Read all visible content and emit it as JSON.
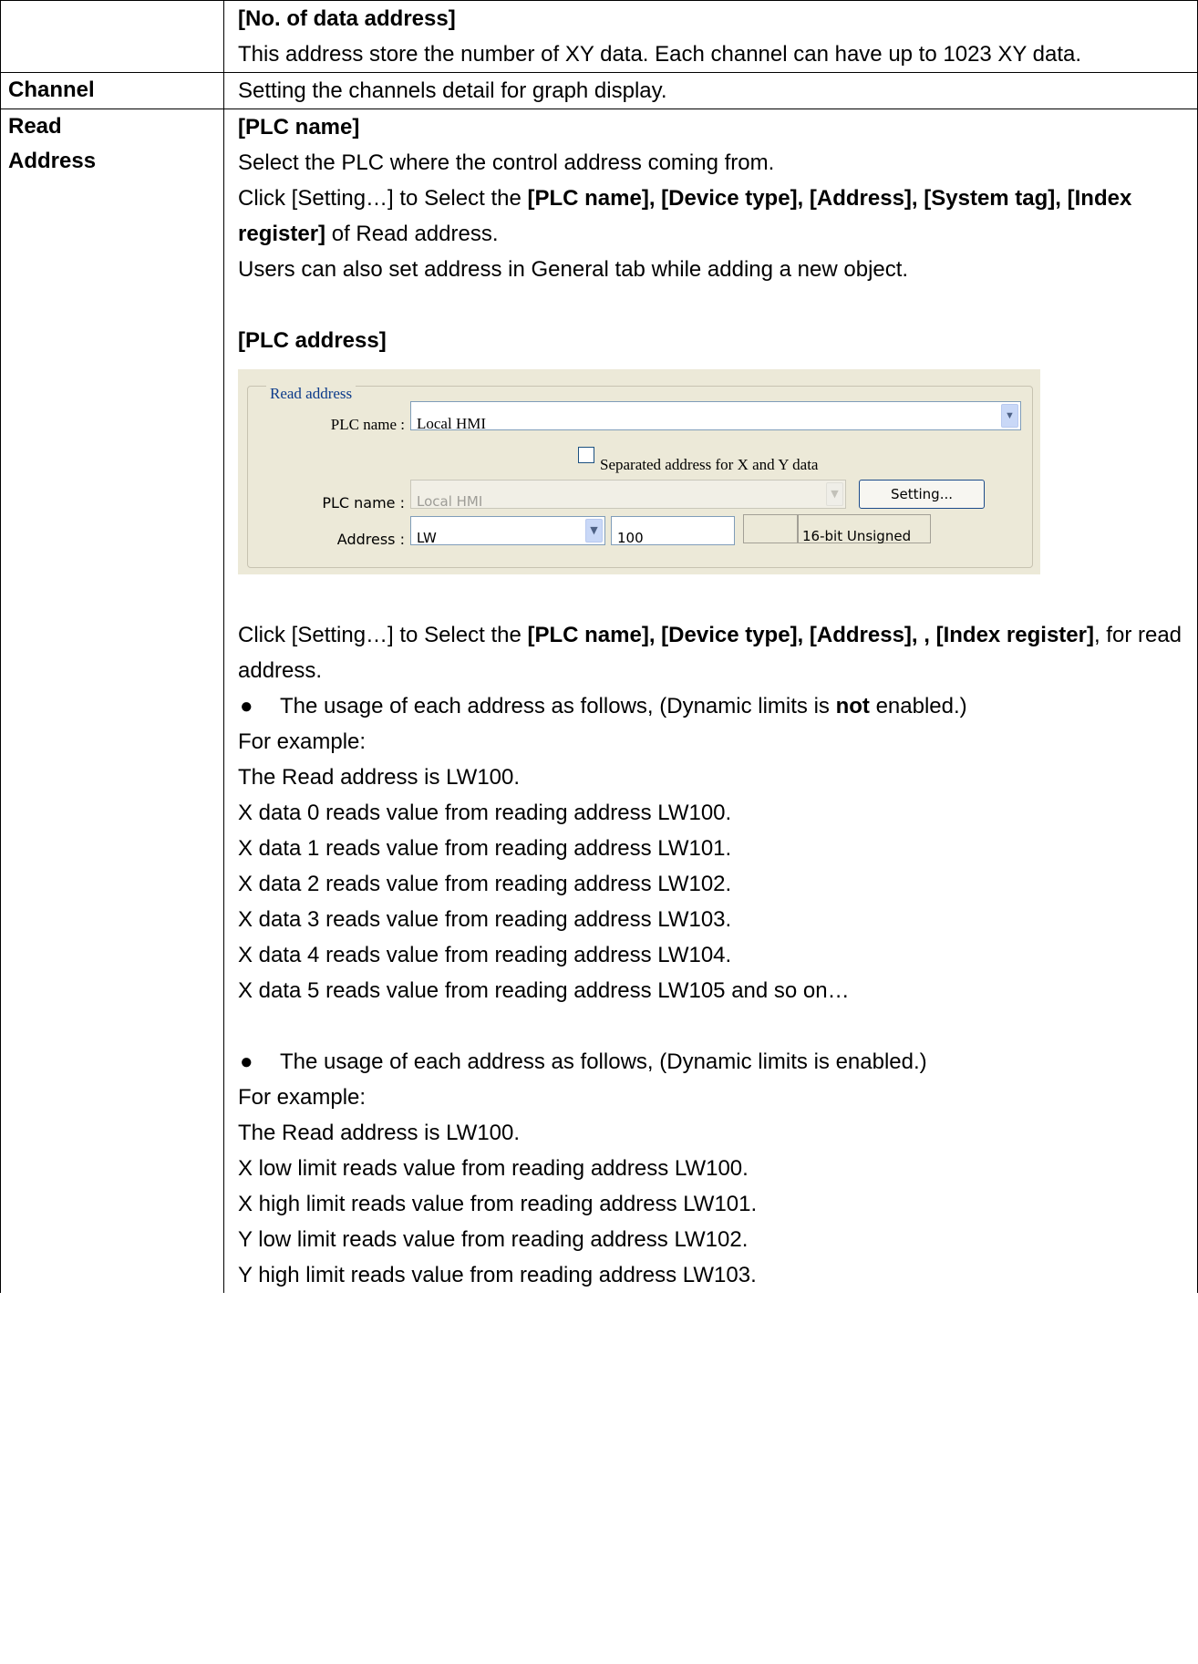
{
  "rows": [
    {
      "label": "",
      "lines": [
        "[No. of data address]",
        "This address store the number of XY data. Each channel can have up to 1023 XY data."
      ]
    },
    {
      "label": "Channel",
      "lines": [
        "Setting the channels detail for graph display."
      ]
    },
    {
      "label": "Read Address",
      "intro": {
        "heading": "[PLC name]",
        "p1": "Select the PLC where the control address coming from.",
        "p2_pre": "Click [Setting…] to Select the ",
        "p2_bold": "[PLC name], [Device type], [Address], [System tag], [Index register]",
        "p2_post": " of Read address.",
        "p3": "Users can also set address in General tab while adding a new object.",
        "heading2": "[PLC address]"
      },
      "dialog": {
        "group_title": "Read address",
        "plc_name_label": "PLC name :",
        "plc_name_value": "Local HMI",
        "separated_label": "Separated address for X and Y data",
        "plc_name2_label": "PLC name :",
        "plc_name2_value": "Local HMI",
        "setting_button": "Setting...",
        "address_label": "Address :",
        "device_value": "LW",
        "address_value": "100",
        "format_value": "16-bit Unsigned"
      },
      "after": {
        "p1_pre": "Click [Setting…] to Select the ",
        "p1_bold": "[PLC name], [Device type], [Address], , [Index register]",
        "p1_post": ", for read address.",
        "bullet1_pre": "The usage of each address as follows, (Dynamic limits is ",
        "bullet1_bold": "not",
        "bullet1_post": "enabled.)",
        "example1": "For example:",
        "read1": "The Read address is LW100.",
        "xlines": [
          "X data 0 reads value from reading address LW100.",
          "X data 1 reads value from reading address LW101.",
          "X data 2 reads value from reading address LW102.",
          "X data 3 reads value from reading address LW103.",
          "X data 4 reads value from reading address LW104.",
          "X data 5 reads value from reading address LW105 and so on…"
        ],
        "bullet2": "The usage of each address as follows, (Dynamic limits is enabled.)",
        "example2": "For example:",
        "read2": "The Read address is LW100.",
        "limits": [
          "X low limit reads value from reading address LW100.",
          "X high limit reads value from reading address LW101.",
          "Y low limit reads value from reading address LW102.",
          "Y high limit reads value from reading address LW103."
        ]
      }
    }
  ],
  "bullet_glyph": "●",
  "dropdown_glyph": "▼"
}
